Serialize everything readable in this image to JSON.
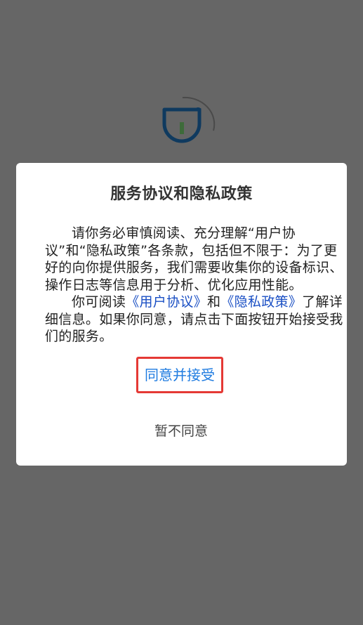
{
  "splash": {
    "logo_icon": "app-logo-icon",
    "spinner_icon": "loading-spinner-icon",
    "logo_color": "#0f3a5f",
    "logo_accent": "#3d6b3a"
  },
  "dialog": {
    "title": "服务协议和隐私政策",
    "paragraph1": "请你务必审慎阅读、充分理解“用户协议”和“隐私政策”各条款，包括但不限于：为了更好的向你提供服务，我们需要收集你的设备标识、操作日志等信息用于分析、优化应用性能。",
    "paragraph2_prefix": "你可阅读",
    "user_agreement_link": "《用户协议》",
    "paragraph2_and": "和",
    "privacy_policy_link": "《隐私政策》",
    "paragraph2_suffix": "了解详细信息。如果你同意，请点击下面按钮开始接受我们的服务。",
    "accept_label": "同意并接受",
    "decline_label": "暂不同意"
  },
  "colors": {
    "overlay": "#666666",
    "link": "#1a4fc4",
    "accept_text": "#1e7be0",
    "accept_highlight_border": "#e53935"
  }
}
